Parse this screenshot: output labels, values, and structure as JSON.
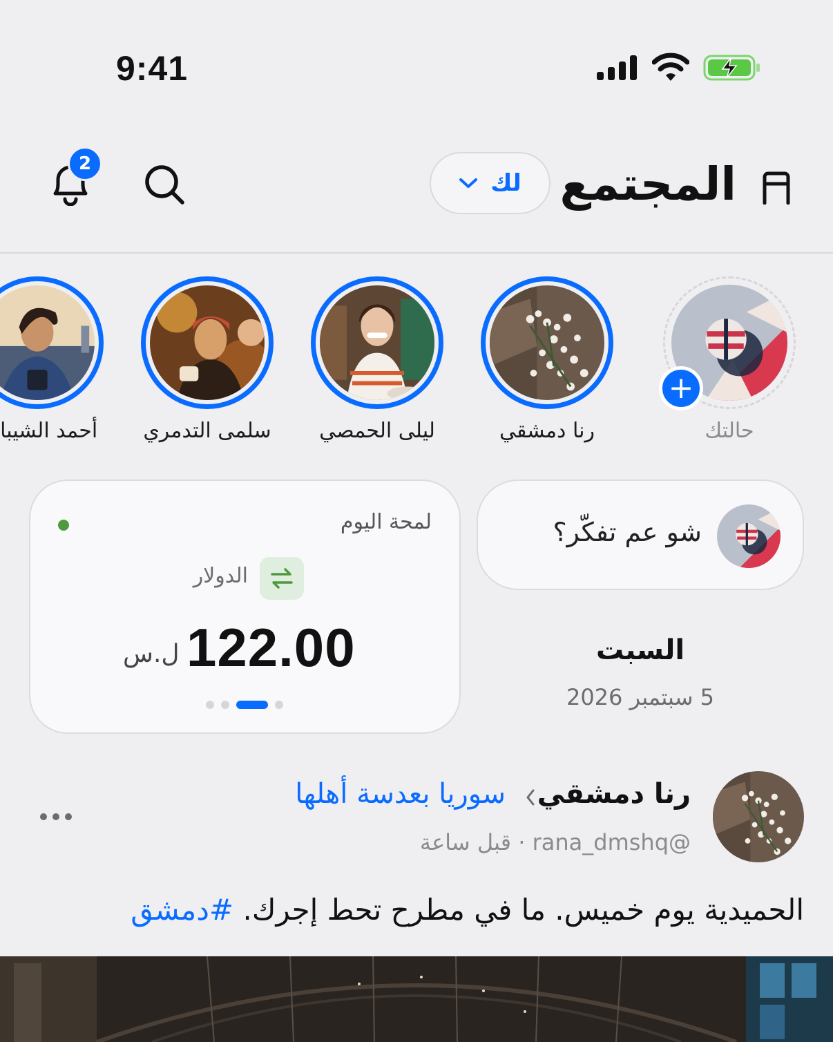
{
  "status_bar": {
    "time": "9:41"
  },
  "header": {
    "title": "المجتمع",
    "feed_filter": "لك",
    "notifications_count": "2"
  },
  "stories": [
    {
      "name": "حالتك",
      "self": true
    },
    {
      "name": "رنا دمشقي"
    },
    {
      "name": "ليلى الحمصي"
    },
    {
      "name": "سلمى التدمري"
    },
    {
      "name": "أحمد الشيباني"
    }
  ],
  "composer": {
    "placeholder": "شو عم تفكّر؟"
  },
  "date": {
    "day": "السبت",
    "full": "5 سبتمبر 2026"
  },
  "widget": {
    "title": "لمحة اليوم",
    "currency": "الدولار",
    "value": "122.00",
    "unit": "ل.س",
    "pages": 4,
    "active_page": 3
  },
  "post": {
    "author": "رنا دمشقي",
    "community": "سوريا بعدسة أهلها",
    "meta": "@rana_dmshq · قبل ساعة",
    "text": "الحميدية يوم خميس. ما في مطرح تحط إجرك.",
    "hashtag": "#دمشق"
  },
  "colors": {
    "accent": "#0a6cff",
    "background": "#efeff2",
    "live": "#4f9a3e"
  }
}
